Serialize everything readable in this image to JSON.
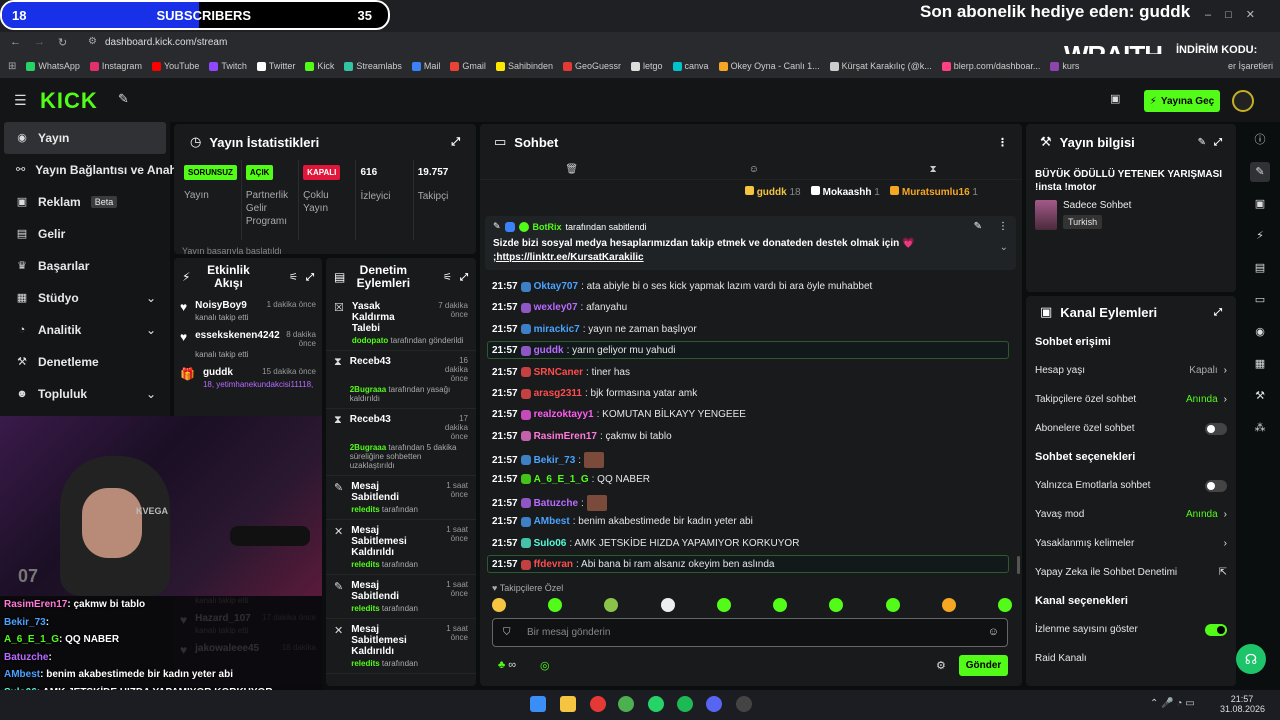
{
  "overlay": {
    "sub_count_left": "18",
    "sub_label": "SUBSCRIBERS",
    "sub_count_right": "35",
    "sub_progress": 0.51,
    "last_gift": "Son abonelik hediye eden: guddk",
    "brand": "WRAITH.",
    "discount": "İNDİRİM KODU:",
    "code": "QQ"
  },
  "browser": {
    "url": "dashboard.kick.com/stream",
    "bookmarks": [
      {
        "label": "WhatsApp",
        "color": "#25d366"
      },
      {
        "label": "Instagram",
        "color": "#e1306c"
      },
      {
        "label": "YouTube",
        "color": "#ff0000"
      },
      {
        "label": "Twitch",
        "color": "#9146ff"
      },
      {
        "label": "Twitter",
        "color": "#ffffff"
      },
      {
        "label": "Kick",
        "color": "#53fc18"
      },
      {
        "label": "Streamlabs",
        "color": "#31c3a2"
      },
      {
        "label": "Mail",
        "color": "#3b82f6"
      },
      {
        "label": "Gmail",
        "color": "#ea4335"
      },
      {
        "label": "Sahibinden",
        "color": "#ffe800"
      },
      {
        "label": "GeoGuessr",
        "color": "#e53935"
      },
      {
        "label": "letgo",
        "color": "#dddddd"
      },
      {
        "label": "canva",
        "color": "#00c4cc"
      },
      {
        "label": "Okey Oyna - Canlı 1...",
        "color": "#f5a623"
      },
      {
        "label": "Kürşat Karakılıç (@k...",
        "color": "#cccccc"
      },
      {
        "label": "blerp.com/dashboar...",
        "color": "#ff4081"
      },
      {
        "label": "kurs",
        "color": "#8e44ad"
      }
    ],
    "other_bookmarks": "er İşaretleri"
  },
  "kick": {
    "logo": "KICK",
    "go_live": "Yayına Geç"
  },
  "sidebar": [
    {
      "label": "Yayın",
      "icon": "broadcast-icon",
      "glyph": "◉"
    },
    {
      "label": "Yayın Bağlantısı ve Anahtar",
      "icon": "link-icon",
      "glyph": "⚯"
    },
    {
      "label": "Reklam",
      "icon": "ad-icon",
      "glyph": "▣",
      "badge": "Beta"
    },
    {
      "label": "Gelir",
      "icon": "revenue-icon",
      "glyph": "▤"
    },
    {
      "label": "Başarılar",
      "icon": "trophy-icon",
      "glyph": "♛"
    },
    {
      "label": "Stüdyo",
      "icon": "studio-icon",
      "glyph": "▦",
      "chev": "⌄"
    },
    {
      "label": "Analitik",
      "icon": "analytics-icon",
      "glyph": "◔",
      "chev": "⌄"
    },
    {
      "label": "Denetleme",
      "icon": "moderation-icon",
      "glyph": "⚒"
    },
    {
      "label": "Topluluk",
      "icon": "community-icon",
      "glyph": "☻",
      "chev": "⌄"
    }
  ],
  "stats": {
    "title": "Yayın İstatistikleri",
    "items": [
      {
        "badge": "SORUNSUZ",
        "label": "Yayın",
        "color": "#53fc18"
      },
      {
        "badge": "AÇIK",
        "label": "Partnerlik Gelir Programı",
        "color": "#53fc18"
      },
      {
        "badge": "KAPALI",
        "label": "Çoklu Yayın",
        "color": "#e0173b"
      },
      {
        "badge": "616",
        "label": "İzleyici"
      },
      {
        "badge": "19.757",
        "label": "Takipçi"
      }
    ],
    "peek": "Yayın başarıyla başlatıldı"
  },
  "activity": {
    "title": "Etkinlik Akışı",
    "items": [
      {
        "name": "NoisyBoy9",
        "time": "1 dakika önce",
        "desc": "kanalı takip etti"
      },
      {
        "name": "essekskenen4242",
        "time": "8 dakika önce",
        "desc": "kanalı takip etti"
      },
      {
        "name": "guddk",
        "time": "15 dakika önce",
        "desc": "18, yetimhanekundakcisi11118,"
      },
      {
        "name": "Genco22",
        "time": "17 dakika önce",
        "desc": "kanalı takip etti"
      },
      {
        "name": "Hazard_107",
        "time": "17 dakika önce",
        "desc": "kanalı takip etti"
      },
      {
        "name": "jakowaleee45",
        "time": "18 dakika",
        "desc": ""
      }
    ]
  },
  "mod": {
    "title": "Denetim Eylemleri",
    "items": [
      {
        "action": "Yasak Kaldırma Talebi",
        "time": "7 dakika önce",
        "by": "dodopato",
        "desc": "tarafından gönderildi"
      },
      {
        "action": "Receb43",
        "time": "16 dakika önce",
        "by": "2Bugraaa",
        "desc": "tarafından yasağı kaldırıldı"
      },
      {
        "action": "Receb43",
        "time": "17 dakika önce",
        "by": "2Bugraaa",
        "desc": "tarafından 5 dakika süreliğine sohbetten uzaklaştırıldı"
      },
      {
        "action": "Mesaj Sabitlendi",
        "time": "1 saat önce",
        "by": "reledits",
        "desc": "tarafından"
      },
      {
        "action": "Mesaj Sabitlemesi Kaldırıldı",
        "time": "1 saat önce",
        "by": "reledits",
        "desc": "tarafından"
      },
      {
        "action": "Mesaj Sabitlendi",
        "time": "1 saat önce",
        "by": "reledits",
        "desc": "tarafından"
      },
      {
        "action": "Mesaj Sabitlemesi Kaldırıldı",
        "time": "1 saat önce",
        "by": "reledits",
        "desc": "tarafından"
      }
    ]
  },
  "chat": {
    "title": "Sohbet",
    "top_gifters": [
      {
        "name": "guddk",
        "count": "18",
        "color": "#f5c542"
      },
      {
        "name": "Mokaashh",
        "count": "1",
        "color": "#ffffff"
      },
      {
        "name": "Muratsumlu16",
        "count": "1",
        "color": "#f5a623"
      }
    ],
    "pinned_by": "BotRix",
    "pinned_by_suffix": "tarafından sabitlendi",
    "pinned_text": "Sizde bizi sosyal medya hesaplarımızdan takip etmek ve donateden destek olmak için 💗",
    "pinned_link": ";https://linktr.ee/KursatKarakilic",
    "messages": [
      {
        "time": "21:57",
        "user": "Oktay707",
        "color": "#4aa3ff",
        "text": ": ata abiyle bi o ses kick yapmak lazım vardı bi ara öyle muhabbet"
      },
      {
        "time": "21:57",
        "user": "wexley07",
        "color": "#b86bff",
        "text": ": afanyahu"
      },
      {
        "time": "21:57",
        "user": "mirackic7",
        "color": "#4aa3ff",
        "text": ": yayın ne zaman başlıyor"
      },
      {
        "time": "21:57",
        "user": "guddk",
        "color": "#b86bff",
        "text": ": yarın geliyor mu yahudi",
        "hl": true
      },
      {
        "time": "21:57",
        "user": "SRNCaner",
        "color": "#ff4d4d",
        "text": ": tiner has"
      },
      {
        "time": "21:57",
        "user": "arasg2311",
        "color": "#ff4d4d",
        "text": ": bjk formasına yatar amk"
      },
      {
        "time": "21:57",
        "user": "realzoktayy1",
        "color": "#ff5cf0",
        "text": ": KOMUTAN BİLKAYY YENGEEE"
      },
      {
        "time": "21:57",
        "user": "RasimEren17",
        "color": "#ff7ad9",
        "text": ": çakmw bi tablo"
      },
      {
        "time": "21:57",
        "user": "Bekir_73",
        "color": "#4aa3ff",
        "text": ":",
        "emote": true
      },
      {
        "time": "21:57",
        "user": "A_6_E_1_G",
        "color": "#53fc18",
        "text": ": QQ NABER"
      },
      {
        "time": "21:57",
        "user": "Batuzche",
        "color": "#b86bff",
        "text": ":",
        "emote": true
      },
      {
        "time": "21:57",
        "user": "AMbest",
        "color": "#4aa3ff",
        "text": ": benim akabestimede bir kadın yeter abi"
      },
      {
        "time": "21:57",
        "user": "Sulo06",
        "color": "#53fcd8",
        "text": ": AMK JETSKİDE HIZDA YAPAMIYOR KORKUYOR"
      },
      {
        "time": "21:57",
        "user": "ffdevran",
        "color": "#ff4d4d",
        "text": ": Abi bana bi ram alsanız okeyim ben aslında",
        "hl": true
      }
    ],
    "follower_only": "Takipçilere Özel",
    "input_placeholder": "Bir mesaj gönderin",
    "send": "Gönder"
  },
  "info": {
    "title": "Yayın bilgisi",
    "stream_title": "BÜYÜK ÖDÜLLÜ YETENEK YARIŞMASI !insta !motor",
    "category": "Sadece Sohbet",
    "tag": "Turkish"
  },
  "channel": {
    "title": "Kanal Eylemleri",
    "sections": [
      {
        "header": "Sohbet erişimi",
        "rows": [
          {
            "label": "Hesap yaşı",
            "value": "Kapalı",
            "kind": "chev"
          },
          {
            "label": "Takipçilere özel sohbet",
            "value": "Anında",
            "kind": "chev-green"
          },
          {
            "label": "Abonelere özel sohbet",
            "value": "",
            "kind": "toggle"
          }
        ]
      },
      {
        "header": "Sohbet seçenekleri",
        "rows": [
          {
            "label": "Yalnızca Emotlarla sohbet",
            "value": "",
            "kind": "toggle"
          },
          {
            "label": "Yavaş mod",
            "value": "Anında",
            "kind": "chev-green"
          },
          {
            "label": "Yasaklanmış kelimeler",
            "value": "",
            "kind": "chev"
          },
          {
            "label": "Yapay Zeka ile Sohbet Denetimi",
            "value": "",
            "kind": "ext"
          }
        ]
      },
      {
        "header": "Kanal seçenekleri",
        "rows": [
          {
            "label": "İzlenme sayısını göster",
            "value": "",
            "kind": "toggle-on"
          },
          {
            "label": "Raid Kanalı",
            "value": "",
            "kind": "none"
          }
        ]
      }
    ]
  },
  "stream_overlay_chat": [
    {
      "user": "RasimEren17",
      "color": "#ff7ad9",
      "text": ": çakmw bi tablo"
    },
    {
      "user": "Bekir_73",
      "color": "#4aa3ff",
      "text": ":"
    },
    {
      "user": "A_6_E_1_G",
      "color": "#53fc18",
      "text": ": QQ NABER"
    },
    {
      "user": "Batuzche",
      "color": "#b86bff",
      "text": ":"
    },
    {
      "user": "AMbest",
      "color": "#4aa3ff",
      "text": ": benim akabestimede bir kadın yeter abi"
    },
    {
      "user": "Sulo06",
      "color": "#53fcd8",
      "text": ": AMK JETSKİDE HIZDA YAPAMIYOR KORKUYOR"
    },
    {
      "user": "ffdevran",
      "color": "#ff4d4d",
      "text": ": Abi bana bi ram alsanız okeyim ben aslında"
    }
  ],
  "webcam_text": "KVEGA",
  "jersey": "07",
  "taskbar": {
    "time": "21:57",
    "date": "31.08.2026"
  }
}
